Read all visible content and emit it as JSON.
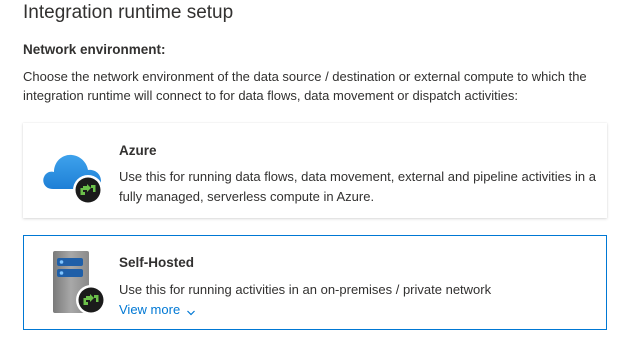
{
  "header": {
    "title": "Integration runtime setup"
  },
  "network": {
    "label": "Network environment:",
    "description": "Choose the network environment of the data source / destination or external compute to which the integration runtime will connect to for data flows, data movement or dispatch activities:"
  },
  "options": [
    {
      "title": "Azure",
      "description": "Use this for running data flows, data movement, external and pipeline activities in a fully managed, serverless compute in Azure.",
      "icon": "azure-cloud-icon",
      "selected": false
    },
    {
      "title": "Self-Hosted",
      "description": "Use this for running activities in an on-premises / private network",
      "icon": "server-icon",
      "selected": true,
      "view_more": "View more"
    }
  ],
  "colors": {
    "accent": "#0078d4",
    "text": "#323130",
    "badge_green": "#5ba82e"
  }
}
